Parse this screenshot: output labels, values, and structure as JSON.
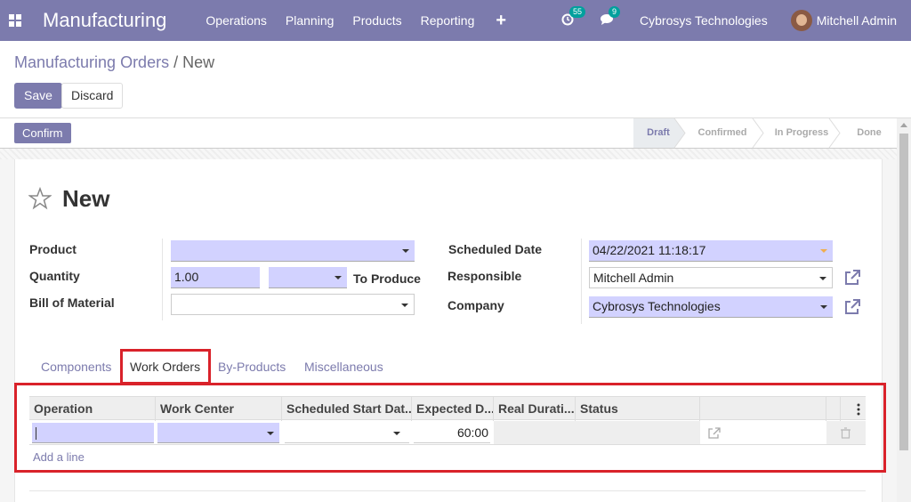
{
  "navbar": {
    "brand": "Manufacturing",
    "menu": [
      "Operations",
      "Planning",
      "Products",
      "Reporting"
    ],
    "activity_badge": "55",
    "message_badge": "9",
    "company": "Cybrosys Technologies",
    "user": "Mitchell Admin"
  },
  "breadcrumb": {
    "parent": "Manufacturing Orders",
    "separator": "/",
    "current": "New"
  },
  "buttons": {
    "save": "Save",
    "discard": "Discard",
    "confirm": "Confirm"
  },
  "stages": [
    "Draft",
    "Confirmed",
    "In Progress",
    "Done"
  ],
  "active_stage": "Draft",
  "form": {
    "title": "New",
    "labels": {
      "product": "Product",
      "quantity": "Quantity",
      "bom": "Bill of Material",
      "scheduled_date": "Scheduled Date",
      "responsible": "Responsible",
      "company": "Company"
    },
    "values": {
      "product": "",
      "quantity": "1.00",
      "uom": "",
      "to_produce": "To Produce",
      "bom": "",
      "scheduled_date": "04/22/2021 11:18:17",
      "responsible": "Mitchell Admin",
      "company": "Cybrosys Technologies"
    }
  },
  "tabs": [
    "Components",
    "Work Orders",
    "By-Products",
    "Miscellaneous"
  ],
  "active_tab": "Work Orders",
  "table": {
    "headers": [
      "Operation",
      "Work Center",
      "Scheduled Start Dat...",
      "Expected D...",
      "Real Durati...",
      "Status"
    ],
    "row": {
      "operation": "",
      "work_center": "",
      "start_date": "",
      "expected": "60:00",
      "real": "",
      "status": ""
    },
    "add_line": "Add a line"
  }
}
